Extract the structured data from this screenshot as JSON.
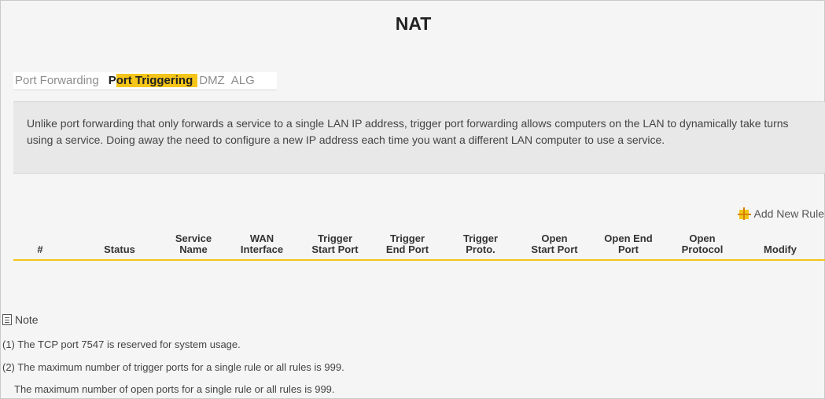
{
  "page": {
    "title": "NAT"
  },
  "tabs": [
    {
      "label": "Port Forwarding"
    },
    {
      "label": "Port Triggering",
      "label_a": "P",
      "label_b": "ort Triggering"
    },
    {
      "label": "DMZ"
    },
    {
      "label": "ALG"
    }
  ],
  "description": "Unlike port forwarding that only forwards a service to a single LAN IP address, trigger port forwarding allows computers on the LAN to dynamically take turns using a service. Doing away the need to configure a new IP address each time you want a different LAN computer to use a service.",
  "add_rule": {
    "label": "Add New Rule",
    "icon": "plus-icon"
  },
  "table": {
    "headers": [
      "#",
      "Status",
      "Service\nName",
      "WAN\nInterface",
      "Trigger\nStart Port",
      "Trigger\nEnd Port",
      "Trigger\nProto.",
      "Open\nStart Port",
      "Open End\nPort",
      "Open\nProtocol",
      "Modify"
    ],
    "rows": []
  },
  "note": {
    "label": "Note",
    "icon": "document-icon",
    "lines": [
      "(1) The TCP port 7547 is reserved for system usage.",
      "(2) The maximum number of trigger ports for a single rule or all rules is 999.",
      "The maximum number of open ports for a single rule or all rules is 999."
    ]
  },
  "colors": {
    "accent": "#f5c518",
    "accent_dark": "#d48200",
    "background": "#f5f5f5"
  }
}
